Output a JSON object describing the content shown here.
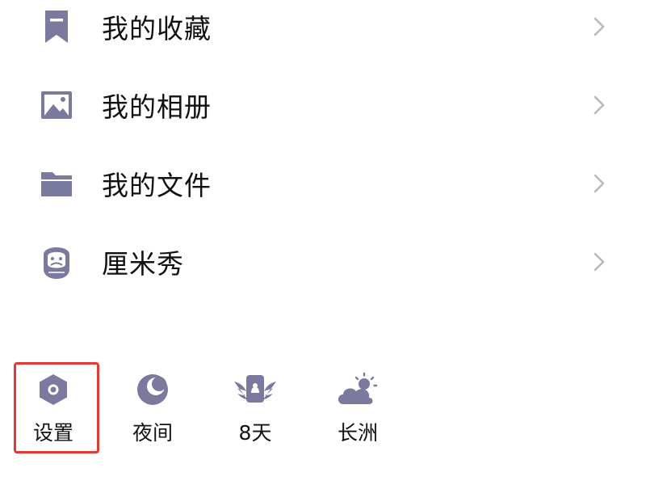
{
  "menu": {
    "items": [
      {
        "label": "我的收藏",
        "icon": "bookmark-icon"
      },
      {
        "label": "我的相册",
        "icon": "image-icon"
      },
      {
        "label": "我的文件",
        "icon": "folder-icon"
      },
      {
        "label": "厘米秀",
        "icon": "mascot-icon"
      }
    ],
    "chevron_icon": "chevron-right-icon"
  },
  "shortcuts": {
    "items": [
      {
        "label": "设置",
        "icon": "settings-hexagon-icon"
      },
      {
        "label": "夜间",
        "icon": "moon-icon"
      },
      {
        "label": "8天",
        "icon": "winged-badge-icon"
      },
      {
        "label": "长洲",
        "icon": "cloudy-sun-icon"
      }
    ]
  },
  "colors": {
    "icon": "#7a7a9e",
    "chevron": "#b9b9c2",
    "text": "#111111",
    "highlight": "#e53935"
  }
}
